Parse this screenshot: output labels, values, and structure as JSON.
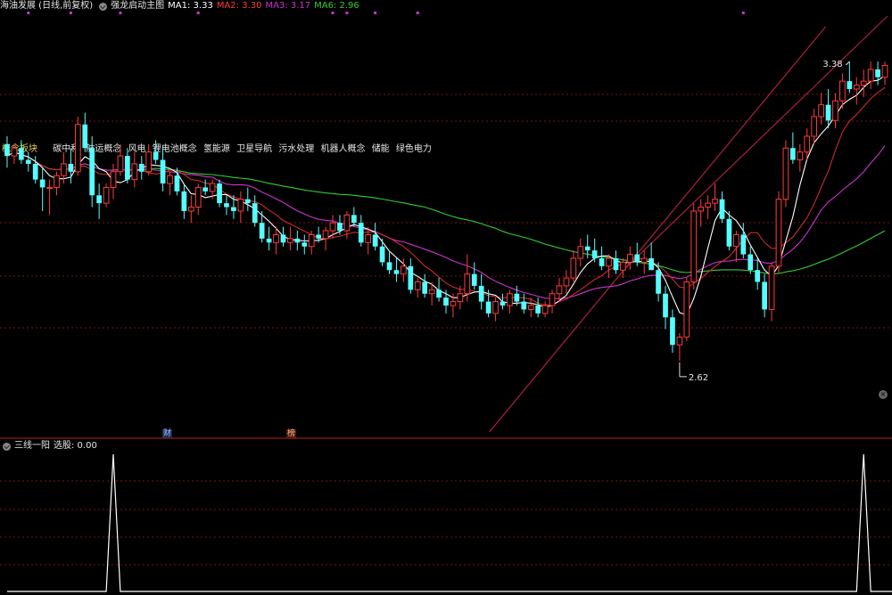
{
  "header": {
    "stock_title": "海油发展 (日线,前复权)",
    "indicator_name": "强龙启动主图",
    "ma1_label": "MA1: 3.33",
    "ma2_label": "MA2: 3.30",
    "ma3_label": "MA3: 3.17",
    "ma6_label": "MA6: 2.96"
  },
  "sub_header": {
    "indicator_name": "三线一阳",
    "value_label": "选股: 0.00"
  },
  "concepts": {
    "title": "概念板块",
    "items": [
      "碳中和",
      "航运概念",
      "风电",
      "锂电池概念",
      "氢能源",
      "卫星导航",
      "污水处理",
      "机器人概念",
      "储能",
      "绿色电力"
    ]
  },
  "tags": {
    "finance": "财",
    "rank": "榜"
  },
  "colors": {
    "up": "#ff3b3b",
    "down": "#54ffff",
    "ma1": "#ffffff",
    "ma2": "#cc2b2b",
    "ma3": "#cc33cc",
    "ma6": "#33cc33",
    "title_yellow": "#e8d44d",
    "grid": "#7a1515",
    "trendline": "#b01f3f",
    "marker": "#cc33cc",
    "signal": "#ffffff"
  },
  "chart_data": [
    {
      "type": "candlestick",
      "name": "main",
      "price_range": [
        2.45,
        3.5
      ],
      "max_label": "3.38",
      "min_label": "2.62",
      "candles": [
        [
          3.17,
          3.19,
          3.11,
          3.14
        ],
        [
          3.14,
          3.17,
          3.12,
          3.16
        ],
        [
          3.16,
          3.18,
          3.12,
          3.13
        ],
        [
          3.13,
          3.15,
          3.1,
          3.12
        ],
        [
          3.12,
          3.14,
          3.07,
          3.08
        ],
        [
          3.08,
          3.11,
          3.0,
          3.06
        ],
        [
          3.06,
          3.08,
          2.99,
          3.06
        ],
        [
          3.06,
          3.1,
          3.04,
          3.09
        ],
        [
          3.09,
          3.15,
          3.07,
          3.12
        ],
        [
          3.12,
          3.16,
          3.07,
          3.1
        ],
        [
          3.1,
          3.24,
          3.09,
          3.22
        ],
        [
          3.22,
          3.25,
          3.15,
          3.16
        ],
        [
          3.16,
          3.19,
          3.01,
          3.04
        ],
        [
          3.04,
          3.07,
          2.98,
          3.02
        ],
        [
          3.02,
          3.07,
          3.01,
          3.06
        ],
        [
          3.06,
          3.12,
          3.03,
          3.1
        ],
        [
          3.1,
          3.17,
          3.09,
          3.14
        ],
        [
          3.14,
          3.16,
          3.07,
          3.08
        ],
        [
          3.08,
          3.15,
          3.06,
          3.12
        ],
        [
          3.12,
          3.14,
          3.08,
          3.1
        ],
        [
          3.1,
          3.17,
          3.09,
          3.15
        ],
        [
          3.15,
          3.18,
          3.12,
          3.13
        ],
        [
          3.13,
          3.16,
          3.05,
          3.07
        ],
        [
          3.07,
          3.1,
          3.04,
          3.09
        ],
        [
          3.09,
          3.11,
          3.04,
          3.05
        ],
        [
          3.05,
          3.07,
          2.98,
          3.0
        ],
        [
          3.0,
          3.04,
          2.97,
          3.01
        ],
        [
          3.01,
          3.07,
          2.99,
          3.06
        ],
        [
          3.06,
          3.08,
          3.04,
          3.05
        ],
        [
          3.05,
          3.08,
          3.03,
          3.07
        ],
        [
          3.07,
          3.08,
          3.01,
          3.02
        ],
        [
          3.02,
          3.04,
          2.99,
          3.01
        ],
        [
          3.01,
          3.04,
          2.98,
          3.0
        ],
        [
          3.0,
          3.05,
          2.97,
          3.03
        ],
        [
          3.03,
          3.06,
          3.0,
          3.02
        ],
        [
          3.02,
          3.04,
          2.96,
          2.97
        ],
        [
          2.97,
          3.0,
          2.92,
          2.93
        ],
        [
          2.93,
          2.96,
          2.9,
          2.92
        ],
        [
          2.92,
          2.96,
          2.89,
          2.94
        ],
        [
          2.94,
          2.96,
          2.91,
          2.92
        ],
        [
          2.92,
          2.96,
          2.9,
          2.93
        ],
        [
          2.93,
          2.95,
          2.9,
          2.92
        ],
        [
          2.92,
          2.94,
          2.89,
          2.91
        ],
        [
          2.91,
          2.95,
          2.89,
          2.94
        ],
        [
          2.94,
          2.96,
          2.92,
          2.93
        ],
        [
          2.93,
          2.96,
          2.9,
          2.95
        ],
        [
          2.95,
          2.99,
          2.93,
          2.97
        ],
        [
          2.97,
          2.99,
          2.94,
          2.95
        ],
        [
          2.95,
          3.0,
          2.93,
          2.99
        ],
        [
          2.99,
          3.01,
          2.96,
          2.97
        ],
        [
          2.97,
          2.99,
          2.91,
          2.92
        ],
        [
          2.92,
          2.96,
          2.89,
          2.94
        ],
        [
          2.94,
          2.97,
          2.9,
          2.91
        ],
        [
          2.91,
          2.93,
          2.86,
          2.87
        ],
        [
          2.87,
          2.9,
          2.84,
          2.85
        ],
        [
          2.85,
          2.88,
          2.82,
          2.84
        ],
        [
          2.84,
          2.88,
          2.82,
          2.86
        ],
        [
          2.86,
          2.88,
          2.79,
          2.8
        ],
        [
          2.8,
          2.83,
          2.78,
          2.82
        ],
        [
          2.82,
          2.84,
          2.78,
          2.79
        ],
        [
          2.79,
          2.82,
          2.76,
          2.8
        ],
        [
          2.8,
          2.83,
          2.77,
          2.78
        ],
        [
          2.78,
          2.8,
          2.74,
          2.76
        ],
        [
          2.76,
          2.79,
          2.73,
          2.77
        ],
        [
          2.77,
          2.81,
          2.75,
          2.79
        ],
        [
          2.79,
          2.89,
          2.77,
          2.84
        ],
        [
          2.84,
          2.87,
          2.8,
          2.81
        ],
        [
          2.81,
          2.84,
          2.75,
          2.77
        ],
        [
          2.77,
          2.8,
          2.73,
          2.74
        ],
        [
          2.74,
          2.78,
          2.72,
          2.77
        ],
        [
          2.77,
          2.79,
          2.75,
          2.76
        ],
        [
          2.76,
          2.8,
          2.74,
          2.79
        ],
        [
          2.79,
          2.81,
          2.76,
          2.77
        ],
        [
          2.77,
          2.79,
          2.74,
          2.75
        ],
        [
          2.75,
          2.78,
          2.73,
          2.76
        ],
        [
          2.76,
          2.78,
          2.73,
          2.74
        ],
        [
          2.74,
          2.77,
          2.73,
          2.76
        ],
        [
          2.76,
          2.8,
          2.74,
          2.79
        ],
        [
          2.79,
          2.83,
          2.77,
          2.81
        ],
        [
          2.81,
          2.85,
          2.79,
          2.83
        ],
        [
          2.83,
          2.9,
          2.82,
          2.88
        ],
        [
          2.88,
          2.93,
          2.86,
          2.91
        ],
        [
          2.91,
          2.94,
          2.88,
          2.9
        ],
        [
          2.9,
          2.93,
          2.87,
          2.88
        ],
        [
          2.88,
          2.91,
          2.85,
          2.86
        ],
        [
          2.86,
          2.89,
          2.83,
          2.88
        ],
        [
          2.88,
          2.9,
          2.84,
          2.85
        ],
        [
          2.85,
          2.88,
          2.83,
          2.87
        ],
        [
          2.87,
          2.91,
          2.85,
          2.89
        ],
        [
          2.89,
          2.92,
          2.86,
          2.87
        ],
        [
          2.87,
          2.9,
          2.84,
          2.88
        ],
        [
          2.88,
          2.92,
          2.86,
          2.85
        ],
        [
          2.85,
          2.87,
          2.77,
          2.79
        ],
        [
          2.79,
          2.81,
          2.7,
          2.73
        ],
        [
          2.73,
          2.75,
          2.64,
          2.66
        ],
        [
          2.66,
          2.69,
          2.62,
          2.68
        ],
        [
          2.68,
          2.83,
          2.67,
          2.82
        ],
        [
          2.82,
          3.02,
          2.8,
          3.0
        ],
        [
          3.0,
          3.03,
          2.96,
          3.01
        ],
        [
          3.01,
          3.04,
          2.98,
          3.02
        ],
        [
          3.02,
          3.07,
          3.0,
          3.03
        ],
        [
          3.03,
          3.05,
          2.97,
          2.98
        ],
        [
          2.98,
          3.0,
          2.9,
          2.91
        ],
        [
          2.91,
          2.95,
          2.87,
          2.94
        ],
        [
          2.94,
          2.97,
          2.88,
          2.89
        ],
        [
          2.89,
          2.91,
          2.84,
          2.85
        ],
        [
          2.85,
          2.88,
          2.8,
          2.82
        ],
        [
          2.82,
          2.84,
          2.73,
          2.75
        ],
        [
          2.75,
          2.87,
          2.72,
          2.86
        ],
        [
          2.86,
          3.05,
          2.84,
          3.03
        ],
        [
          3.03,
          3.18,
          3.01,
          3.16
        ],
        [
          3.16,
          3.2,
          3.12,
          3.13
        ],
        [
          3.13,
          3.17,
          3.1,
          3.15
        ],
        [
          3.15,
          3.21,
          3.13,
          3.19
        ],
        [
          3.19,
          3.26,
          3.17,
          3.24
        ],
        [
          3.24,
          3.3,
          3.22,
          3.27
        ],
        [
          3.27,
          3.31,
          3.21,
          3.23
        ],
        [
          3.23,
          3.3,
          3.21,
          3.28
        ],
        [
          3.28,
          3.35,
          3.26,
          3.33
        ],
        [
          3.33,
          3.38,
          3.3,
          3.31
        ],
        [
          3.31,
          3.34,
          3.27,
          3.32
        ],
        [
          3.32,
          3.36,
          3.29,
          3.33
        ],
        [
          3.33,
          3.38,
          3.31,
          3.36
        ],
        [
          3.36,
          3.38,
          3.32,
          3.34
        ],
        [
          3.34,
          3.38,
          3.32,
          3.37
        ]
      ]
    },
    {
      "type": "line",
      "name": "三线一阳",
      "x": [
        0,
        14,
        15,
        16,
        120,
        121,
        122,
        127
      ],
      "values": [
        0,
        0,
        1,
        0,
        0,
        1,
        0,
        0
      ]
    }
  ]
}
